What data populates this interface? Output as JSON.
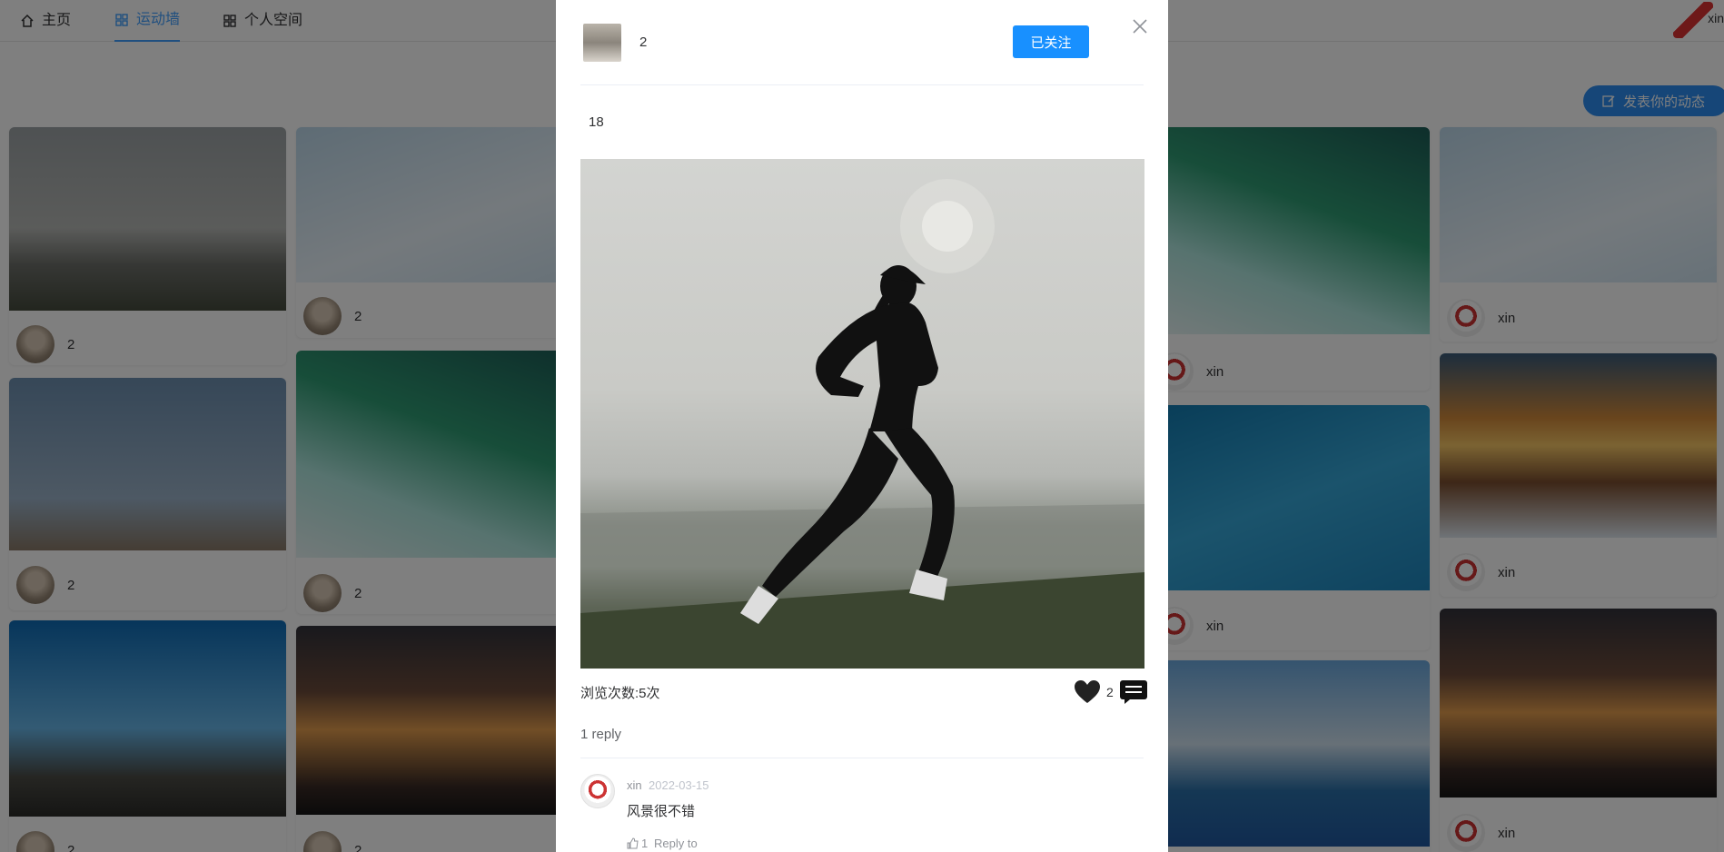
{
  "nav": {
    "items": [
      {
        "label": "主页",
        "icon": "home-icon"
      },
      {
        "label": "运动墙",
        "icon": "grid-icon",
        "active": true
      },
      {
        "label": "个人空间",
        "icon": "grid-icon"
      }
    ],
    "user_label": "xin"
  },
  "post_button": {
    "label": "发表你的动态",
    "icon": "edit-icon"
  },
  "accent_color": "#409eff",
  "feed": {
    "cards": [
      {
        "user": "2"
      },
      {
        "user": "2"
      },
      {
        "user": "2"
      },
      {
        "user": "2"
      },
      {
        "user": "2"
      },
      {
        "user": "2"
      },
      {
        "user": "2"
      },
      {
        "user": "xin"
      },
      {
        "user": "xin"
      },
      {
        "user": "xin"
      },
      {
        "user": "xin"
      },
      {
        "user": "xin"
      },
      {
        "user": "xin"
      }
    ]
  },
  "modal": {
    "author": "2",
    "follow_label": "已关注",
    "content": "18",
    "views": "浏览次数:5次",
    "like_count": "2",
    "reply_count": "1 reply",
    "comment": {
      "user": "xin",
      "date": "2022-03-15",
      "text": "风景很不错",
      "likes": "1",
      "reply_label": "Reply to"
    }
  }
}
